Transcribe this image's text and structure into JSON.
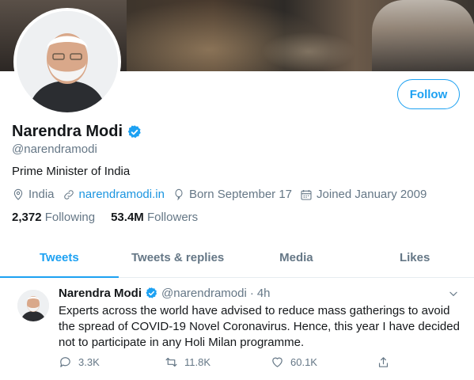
{
  "profile": {
    "name": "Narendra Modi",
    "handle": "@narendramodi",
    "bio": "Prime Minister of India",
    "location": "India",
    "website": "narendramodi.in",
    "birthday": "Born September 17",
    "joined": "Joined January 2009",
    "follow_label": "Follow"
  },
  "stats": {
    "following_count": "2,372",
    "following_label": "Following",
    "followers_count": "53.4M",
    "followers_label": "Followers"
  },
  "tabs": [
    {
      "label": "Tweets",
      "active": true
    },
    {
      "label": "Tweets & replies",
      "active": false
    },
    {
      "label": "Media",
      "active": false
    },
    {
      "label": "Likes",
      "active": false
    }
  ],
  "tweet": {
    "author": "Narendra Modi",
    "handle": "@narendramodi",
    "separator": "·",
    "time": "4h",
    "text": "Experts across the world have advised to reduce mass gatherings to avoid the spread of COVID-19 Novel Coronavirus. Hence, this year I have decided not to participate in any Holi Milan programme.",
    "replies": "3.3K",
    "retweets": "11.8K",
    "likes": "60.1K"
  },
  "icons": {
    "verified": "verified-badge-icon",
    "location": "location-pin-icon",
    "link": "link-icon",
    "birthday": "balloon-icon",
    "calendar": "calendar-icon",
    "reply": "reply-icon",
    "retweet": "retweet-icon",
    "like": "heart-icon",
    "share": "share-icon",
    "more": "chevron-down-icon"
  },
  "colors": {
    "accent": "#1da1f2",
    "link": "#1b95e0",
    "secondary_text": "#657786",
    "primary_text": "#14171a"
  }
}
